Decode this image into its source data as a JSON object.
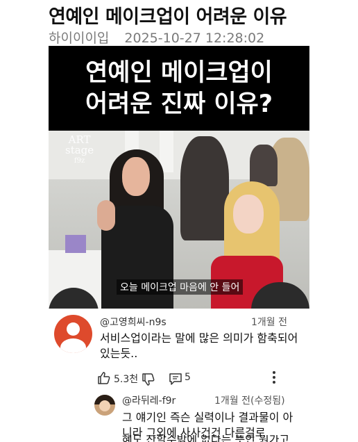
{
  "post": {
    "title": "연예인 메이크업이 어려운 이유",
    "author": "하이이이입",
    "date": "2025-10-27 12:28:02"
  },
  "video": {
    "banner_line1": "연예인 메이크업이",
    "banner_line2": "어려운 진짜 이유?",
    "watermark_line1": "ART",
    "watermark_line2": "stage",
    "watermark_line3": "f9z",
    "subtitle": "오늘 메이크업 마음에 안 들어"
  },
  "comment": {
    "author": "@고영희씨-n9s",
    "time": "1개월 전",
    "text_line1": "서비스업이라는 말에 많은 의미가 함축되어",
    "text_line2": "있는듯..",
    "likes": "5.3천",
    "replies": "5",
    "avatar_color": "#de4a2c"
  },
  "reply": {
    "author": "@라뒤레-f9r",
    "time": "1개월 전(수정됨)",
    "text_line1": "그 얘기인 즉슨 실력이나 결과물이 아",
    "text_line2": "니라 그외에 사사건건 다른걸로",
    "text_line3": "혜도 산할수밖에 없다는 뜻인 원가고"
  },
  "icons": {
    "like": "thumbs-up-icon",
    "dislike": "thumbs-down-icon",
    "reply": "comment-icon",
    "more": "more-vertical-icon"
  }
}
